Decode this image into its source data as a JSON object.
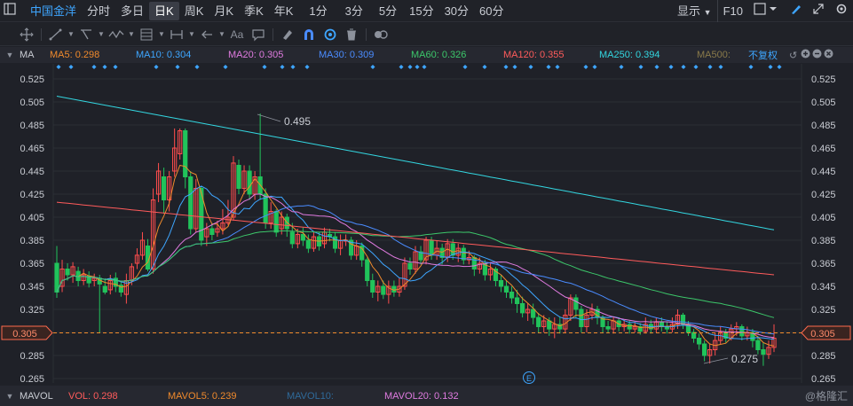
{
  "topbar": {
    "stock_name": "中国金洋",
    "periods": [
      "分时",
      "多日",
      "日K",
      "周K",
      "月K",
      "季K",
      "年K",
      "1分",
      "3分",
      "5分",
      "15分",
      "30分",
      "60分"
    ],
    "active_period": "日K",
    "display_label": "显示",
    "f10_label": "F10"
  },
  "ma_bar": {
    "label": "MA",
    "items": [
      {
        "text": "MA5: 0.298",
        "color": "#f08a2c"
      },
      {
        "text": "MA10: 0.304",
        "color": "#3ea6ff"
      },
      {
        "text": "MA20: 0.305",
        "color": "#e07be0"
      },
      {
        "text": "MA30: 0.309",
        "color": "#4a8cff"
      },
      {
        "text": "MA60: 0.326",
        "color": "#3cc76a"
      },
      {
        "text": "MA120: 0.355",
        "color": "#ff5b5b"
      },
      {
        "text": "MA250: 0.394",
        "color": "#33d6e0"
      },
      {
        "text": "MA500:",
        "color": "#8a7a4a"
      }
    ],
    "adjust_label": "不复权"
  },
  "chart": {
    "left_ticks": [
      "0.525",
      "0.505",
      "0.485",
      "0.465",
      "0.445",
      "0.425",
      "0.405",
      "0.385",
      "0.365",
      "0.345",
      "0.325",
      "0.305",
      "0.285",
      "0.265"
    ],
    "right_ticks": [
      "0.525",
      "0.505",
      "0.485",
      "0.465",
      "0.445",
      "0.425",
      "0.405",
      "0.385",
      "0.365",
      "0.345",
      "0.325",
      "0.305",
      "0.285",
      "0.265"
    ],
    "current_price": "0.305",
    "high_label": "0.495",
    "low_label": "0.275",
    "event_marker": "E"
  },
  "bottom_bar": {
    "label": "MAVOL",
    "vol": "VOL: 0.298",
    "mavol5": "MAVOL5: 0.239",
    "mavol10": "MAVOL10:",
    "mavol20": "MAVOL20: 0.132",
    "watermark": "@格隆汇"
  },
  "colors": {
    "up": "#ff4d4d",
    "down": "#21c35b",
    "bg": "#1f2128",
    "grid": "#2b2e35"
  }
}
